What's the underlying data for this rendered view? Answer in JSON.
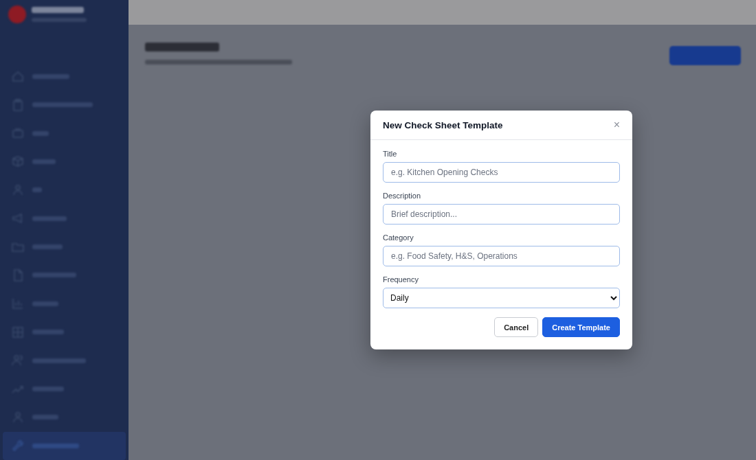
{
  "sidebar": {
    "items": [
      {
        "selected": false
      },
      {
        "selected": false
      },
      {
        "selected": false
      },
      {
        "selected": false
      },
      {
        "selected": false
      },
      {
        "selected": false
      },
      {
        "selected": false
      },
      {
        "selected": false
      },
      {
        "selected": false
      },
      {
        "selected": false
      },
      {
        "selected": false
      },
      {
        "selected": false
      },
      {
        "selected": false
      },
      {
        "selected": true
      }
    ]
  },
  "modal": {
    "title": "New Check Sheet Template",
    "close": "×",
    "fields": [
      {
        "label": "Title",
        "kind": "input",
        "placeholder": "e.g. Kitchen Opening Checks"
      },
      {
        "label": "Description",
        "kind": "input",
        "placeholder": "Brief description..."
      },
      {
        "label": "Category",
        "kind": "input",
        "placeholder": "e.g. Food Safety, H&S, Operations"
      },
      {
        "label": "Frequency",
        "kind": "select",
        "value": "Daily"
      }
    ],
    "buttons": [
      {
        "label": "Cancel",
        "kind": "secondary"
      },
      {
        "label": "Create Template",
        "kind": "primary"
      }
    ]
  }
}
